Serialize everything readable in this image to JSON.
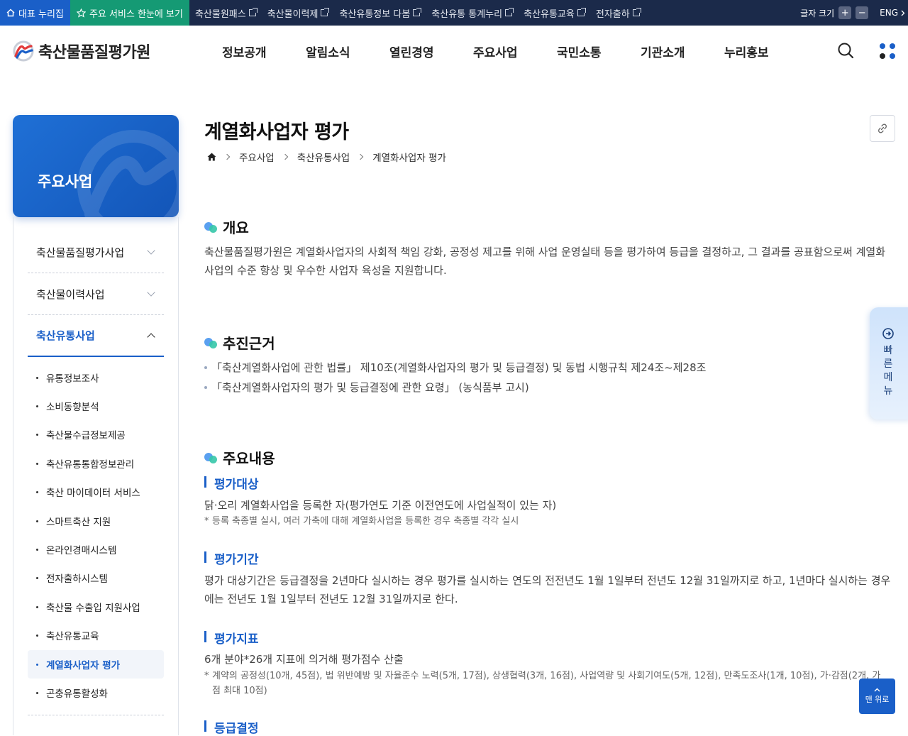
{
  "topbar": {
    "home_label": "대표 누리집",
    "all_services_label": "주요 서비스 한눈에 보기",
    "links": [
      "축산물원패스",
      "축산물이력제",
      "축산유통정보 다봄",
      "축산유통 통계누리",
      "축산유통교육",
      "전자출하"
    ],
    "font_size_label": "글자 크기",
    "font_plus": "+",
    "font_minus": "−",
    "lang_label": "ENG"
  },
  "header": {
    "logo_text": "축산물품질평가원",
    "gnb": [
      "정보공개",
      "알림소식",
      "열린경영",
      "주요사업",
      "국민소통",
      "기관소개",
      "누리홍보"
    ]
  },
  "side": {
    "hero_title": "주요사업",
    "menu": [
      {
        "label": "축산물품질평가사업"
      },
      {
        "label": "축산물이력사업"
      },
      {
        "label": "축산유통사업"
      }
    ],
    "sub_items": [
      "유통정보조사",
      "소비동향분석",
      "축산물수급정보제공",
      "축산유통통합정보관리",
      "축산 마이데이터 서비스",
      "스마트축산 지원",
      "온라인경매시스템",
      "전자출하시스템",
      "축산물 수출입 지원사업",
      "축산유통교육",
      "계열화사업자 평가",
      "곤충유통활성화"
    ]
  },
  "content": {
    "title": "계열화사업자 평가",
    "breadcrumb": [
      "주요사업",
      "축산유통사업",
      "계열화사업자 평가"
    ],
    "overview_title": "개요",
    "overview_text": "축산물품질평가원은 계열화사업자의 사회적 책임 강화, 공정성 제고를 위해 사업 운영실태 등을 평가하여 등급을 결정하고, 그 결과를 공표함으로써 계열화사업의 수준 향상 및 우수한 사업자 육성을 지원합니다.",
    "basis_title": "추진근거",
    "basis_items": [
      "「축산계열화사업에 관한 법률」 제10조(계열화사업자의 평가 및 등급결정) 및 동법 시행규칙 제24조~제28조",
      "「축산계열화사업자의 평가 및 등급결정에 관한 요령」 (농식품부 고시)"
    ],
    "main_title": "주요내용",
    "target_title": "평가대상",
    "target_text": "닭·오리 계열화사업을 등록한 자(평가연도 기준 이전연도에 사업실적이 있는 자)",
    "target_note": "등록 축종별 실시, 여러 가축에 대해 계열화사업을 등록한 경우 축종별 각각 실시",
    "period_title": "평가기간",
    "period_text": "평가 대상기간은 등급결정을 2년마다 실시하는 경우 평가를 실시하는 연도의 전전년도 1월 1일부터 전년도 12월 31일까지로 하고, 1년마다 실시하는 경우에는 전년도 1월 1일부터 전년도 12월 31일까지로 한다.",
    "index_title": "평가지표",
    "index_text": "6개 분야*26개 지표에 의거해 평가점수 산출",
    "index_note": "계약의 공정성(10개, 45점), 법 위반예방 및 자율준수 노력(5개, 17점), 상생협력(3개, 16점), 사업역량 및 사회기여도(5개, 12점), 만족도조사(1개, 10점), 가·감점(2개, 가점 최대 10점)",
    "grade_title": "등급결정"
  },
  "quick_menu_label": "빠른메뉴",
  "to_top_label": "맨 위로",
  "colors": {
    "primary": "#1a5fc8",
    "green": "#159a74",
    "topbar": "#1b2a4a"
  }
}
